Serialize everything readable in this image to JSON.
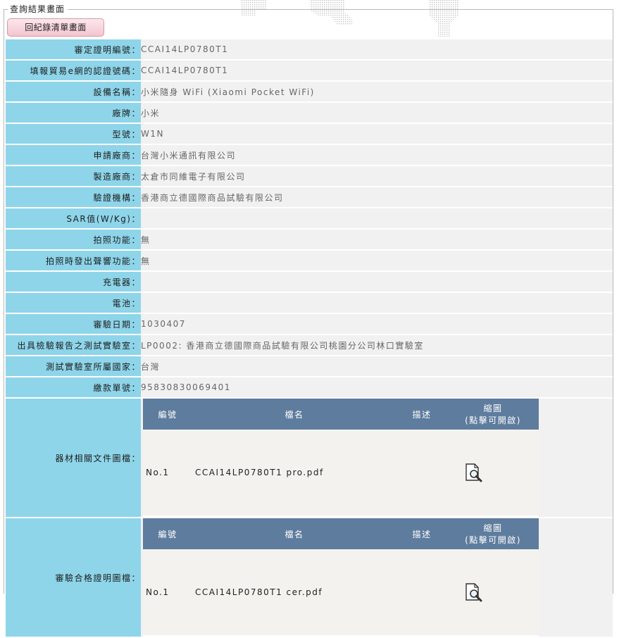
{
  "legend": "查詢結果畫面",
  "back_button": "回紀錄清單畫面",
  "fields": [
    {
      "label": "審定證明編號：",
      "value": "CCAI14LP0780T1"
    },
    {
      "label": "填報貿易e網的認證號碼：",
      "value": "CCAI14LP0780T1"
    },
    {
      "label": "設備名稱：",
      "value": "小米隨身 WiFi (Xiaomi Pocket WiFi)"
    },
    {
      "label": "廠牌：",
      "value": "小米"
    },
    {
      "label": "型號：",
      "value": "W1N"
    },
    {
      "label": "申請廠商：",
      "value": "台灣小米通訊有限公司"
    },
    {
      "label": "製造廠商：",
      "value": "太倉市同維電子有限公司"
    },
    {
      "label": "驗證機構：",
      "value": "香港商立德國際商品試驗有限公司"
    },
    {
      "label": "SAR值(W/Kg)：",
      "value": ""
    },
    {
      "label": "拍照功能：",
      "value": "無"
    },
    {
      "label": "拍照時發出聲響功能：",
      "value": "無"
    },
    {
      "label": "充電器：",
      "value": ""
    },
    {
      "label": "電池：",
      "value": ""
    },
    {
      "label": "審驗日期：",
      "value": "1030407"
    },
    {
      "label": "出具檢驗報告之測試實驗室：",
      "value": "LP0002: 香港商立德國際商品試驗有限公司桃園分公司林口實驗室"
    },
    {
      "label": "測試實驗室所屬國家：",
      "value": "台灣"
    },
    {
      "label": "繳款單號：",
      "value": "95830830069401"
    }
  ],
  "file_headers": {
    "no": "編號",
    "name": "檔名",
    "desc": "描述",
    "thumb_line1": "縮圖",
    "thumb_line2": "(點擊可開啟)"
  },
  "equipment_docs": {
    "label": "器材相關文件圖檔：",
    "rows": [
      {
        "no": "No.1",
        "name": "CCAI14LP0780T1 pro.pdf",
        "desc": "",
        "icon": "magnifier-document-icon"
      }
    ]
  },
  "approval_docs": {
    "label": "審驗合格證明圖檔：",
    "rows": [
      {
        "no": "No.1",
        "name": "CCAI14LP0780T1 cer.pdf",
        "desc": "",
        "icon": "magnifier-document-icon"
      }
    ]
  },
  "colors": {
    "label_bg": "#8ed5ea",
    "value_bg": "#f1f1f1",
    "header_bg": "#5e7c9d",
    "button_bg": "#f3c5cf"
  }
}
